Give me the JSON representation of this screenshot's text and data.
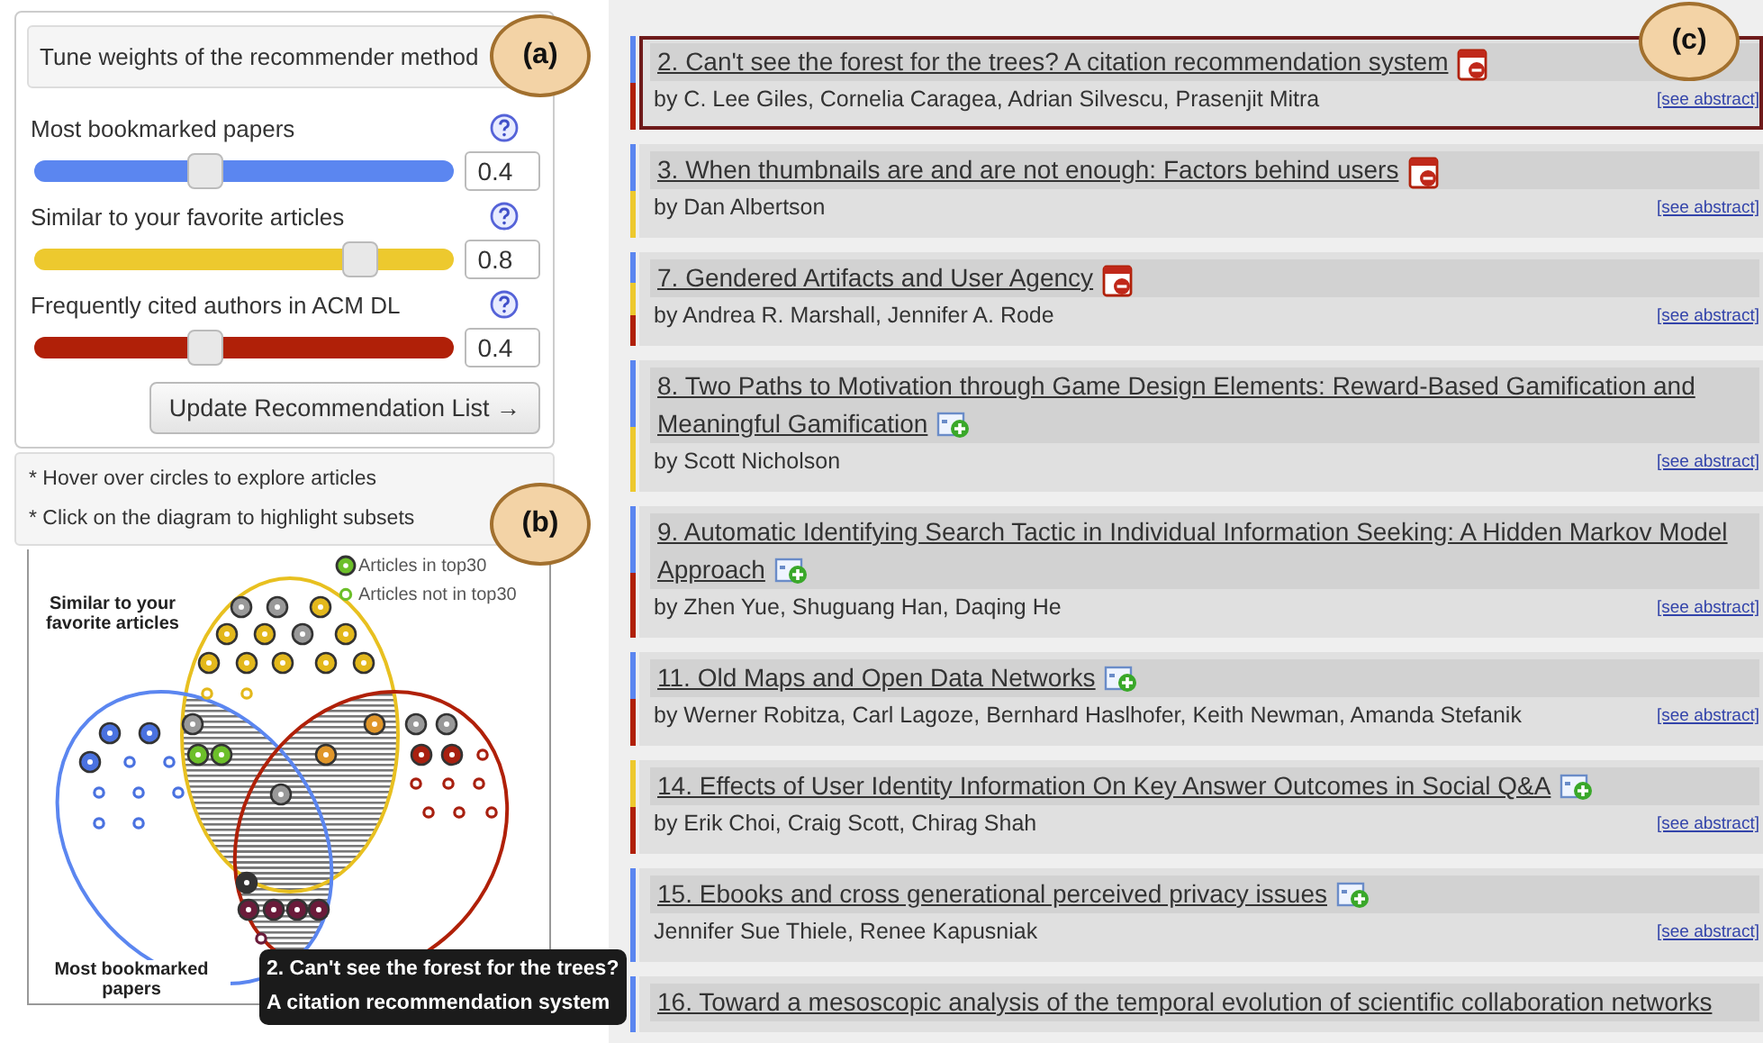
{
  "tuner": {
    "header": "Tune weights of the recommender method",
    "sliders": [
      {
        "label": "Most bookmarked papers",
        "color": "#5b86f0",
        "level": 0.4,
        "value": "0.4"
      },
      {
        "label": "Similar to your favorite articles",
        "color": "#edc92e",
        "level": 0.8,
        "value": "0.8"
      },
      {
        "label": "Frequently cited authors in ACM DL",
        "color": "#b02008",
        "level": 0.4,
        "value": "0.4"
      }
    ],
    "button": "Update Recommendation List →"
  },
  "hints": [
    "* Hover over circles to explore articles",
    "* Click on the diagram to highlight subsets"
  ],
  "venn": {
    "legend": [
      "Articles in top30",
      "Articles not in top30"
    ],
    "set_labels": [
      "Similar to your favorite articles",
      "Most bookmarked papers"
    ],
    "tooltip": [
      "2. Can't see the forest for the trees?",
      "A citation recommendation system"
    ]
  },
  "callouts": [
    "(a)",
    "(b)",
    "(c)"
  ],
  "articles": [
    {
      "title": "2. Can't see the forest for the trees? A citation recommendation system",
      "authors": "by C. Lee Giles, Cornelia Caragea, Adrian Silvescu, Prasenjit Mitra",
      "link": "[see abstract]",
      "kind": "remove",
      "selected": true,
      "stripes": [
        {
          "color": "#5b86f0"
        },
        {
          "color": "#b02008"
        }
      ]
    },
    {
      "title": "3. When thumbnails are and are not enough: Factors behind users",
      "authors": "by Dan Albertson",
      "link": "[see abstract]",
      "kind": "remove",
      "selected": false,
      "stripes": [
        {
          "color": "#5b86f0"
        },
        {
          "color": "#edc92e"
        }
      ]
    },
    {
      "title": "7. Gendered Artifacts and User Agency",
      "authors": "by Andrea R. Marshall, Jennifer A. Rode",
      "link": "[see abstract]",
      "kind": "remove",
      "selected": false,
      "stripes": [
        {
          "color": "#5b86f0"
        },
        {
          "color": "#edc92e"
        },
        {
          "color": "#b02008"
        }
      ]
    },
    {
      "title": "8. Two Paths to Motivation through Game Design Elements: Reward-Based Gamification and Meaningful Gamification",
      "authors": "by Scott Nicholson",
      "link": "[see abstract]",
      "kind": "add",
      "selected": false,
      "stripes": [
        {
          "color": "#5b86f0"
        },
        {
          "color": "#edc92e"
        }
      ]
    },
    {
      "title": "9. Automatic Identifying Search Tactic in Individual Information Seeking: A Hidden Markov Model Approach",
      "authors": "by Zhen Yue, Shuguang Han, Daqing He",
      "link": "[see abstract]",
      "kind": "add",
      "selected": false,
      "stripes": [
        {
          "color": "#5b86f0"
        },
        {
          "color": "#b02008"
        }
      ]
    },
    {
      "title": "11. Old Maps and Open Data Networks",
      "authors": "by Werner Robitza, Carl Lagoze, Bernhard Haslhofer, Keith Newman, Amanda Stefanik",
      "link": "[see abstract]",
      "kind": "add",
      "selected": false,
      "stripes": [
        {
          "color": "#5b86f0"
        },
        {
          "color": "#b02008"
        }
      ]
    },
    {
      "title": "14. Effects of User Identity Information On Key Answer Outcomes in Social Q&A",
      "authors": "by Erik Choi, Craig Scott, Chirag Shah",
      "link": "[see abstract]",
      "kind": "add",
      "selected": false,
      "stripes": [
        {
          "color": "#edc92e"
        },
        {
          "color": "#b02008"
        }
      ]
    },
    {
      "title": "15. Ebooks and cross generational perceived privacy issues",
      "authors": "Jennifer Sue Thiele, Renee Kapusniak",
      "link": "[see abstract]",
      "kind": "add",
      "selected": false,
      "stripes": [
        {
          "color": "#5b86f0"
        }
      ]
    },
    {
      "title": "16. Toward a mesoscopic analysis of the temporal evolution of scientific collaboration networks",
      "selected": false,
      "stripes": [
        {
          "color": "#5b86f0"
        }
      ]
    }
  ]
}
